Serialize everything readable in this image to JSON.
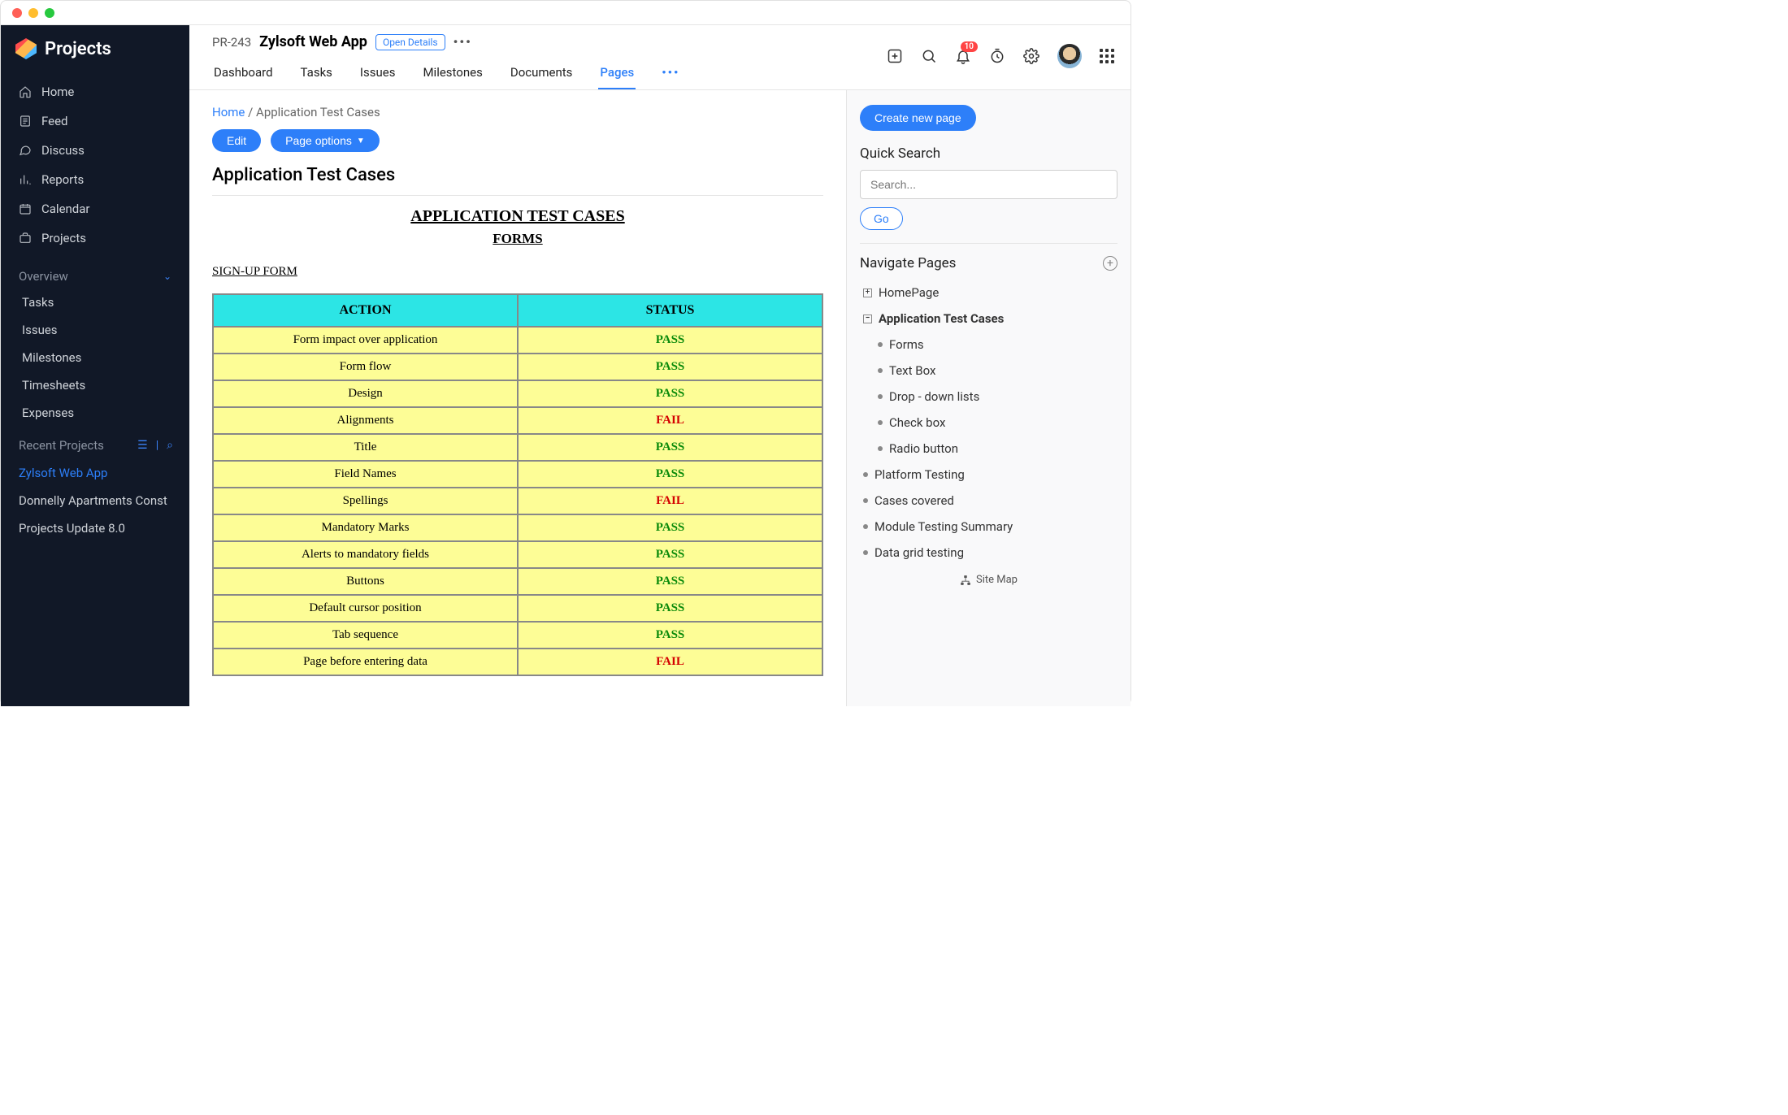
{
  "app_name": "Projects",
  "sidebar": {
    "nav": [
      {
        "label": "Home",
        "icon": "home"
      },
      {
        "label": "Feed",
        "icon": "feed"
      },
      {
        "label": "Discuss",
        "icon": "discuss"
      },
      {
        "label": "Reports",
        "icon": "reports"
      },
      {
        "label": "Calendar",
        "icon": "calendar"
      },
      {
        "label": "Projects",
        "icon": "projects"
      }
    ],
    "section_title": "Overview",
    "section_items": [
      "Tasks",
      "Issues",
      "Milestones",
      "Timesheets",
      "Expenses"
    ],
    "recent_title": "Recent Projects",
    "recent_items": [
      {
        "label": "Zylsoft Web App",
        "active": true
      },
      {
        "label": "Donnelly Apartments Const",
        "active": false
      },
      {
        "label": "Projects Update 8.0",
        "active": false
      }
    ]
  },
  "header": {
    "code": "PR-243",
    "title": "Zylsoft Web App",
    "open_details": "Open Details",
    "tabs": [
      "Dashboard",
      "Tasks",
      "Issues",
      "Milestones",
      "Documents",
      "Pages"
    ],
    "active_tab": "Pages",
    "notifications_count": "10"
  },
  "breadcrumb": {
    "home": "Home",
    "current": "Application Test Cases"
  },
  "buttons": {
    "edit": "Edit",
    "page_options": "Page options"
  },
  "page_title": "Application Test Cases",
  "doc": {
    "title": "APPLICATION TEST CASES",
    "subtitle": "FORMS",
    "section": "SIGN-UP FORM"
  },
  "table": {
    "headers": [
      "ACTION",
      "STATUS"
    ],
    "rows": [
      {
        "action": "Form impact over application",
        "status": "PASS"
      },
      {
        "action": "Form flow",
        "status": "PASS"
      },
      {
        "action": "Design",
        "status": "PASS"
      },
      {
        "action": "Alignments",
        "status": "FAIL"
      },
      {
        "action": "Title",
        "status": "PASS"
      },
      {
        "action": "Field Names",
        "status": "PASS"
      },
      {
        "action": "Spellings",
        "status": "FAIL"
      },
      {
        "action": "Mandatory Marks",
        "status": "PASS"
      },
      {
        "action": "Alerts to mandatory fields",
        "status": "PASS"
      },
      {
        "action": "Buttons",
        "status": "PASS"
      },
      {
        "action": "Default cursor position",
        "status": "PASS"
      },
      {
        "action": "Tab sequence",
        "status": "PASS"
      },
      {
        "action": "Page before entering data",
        "status": "FAIL"
      }
    ]
  },
  "rpanel": {
    "create": "Create new page",
    "quick_search": "Quick Search",
    "search_placeholder": "Search...",
    "go": "Go",
    "navigate": "Navigate Pages",
    "tree": {
      "root1": "HomePage",
      "root2": "Application Test Cases",
      "root2_children": [
        "Forms",
        "Text Box",
        "Drop - down lists",
        "Check box",
        "Radio button"
      ],
      "siblings": [
        "Platform Testing",
        "Cases covered",
        "Module Testing Summary",
        "Data grid testing"
      ]
    },
    "sitemap": "Site Map"
  }
}
